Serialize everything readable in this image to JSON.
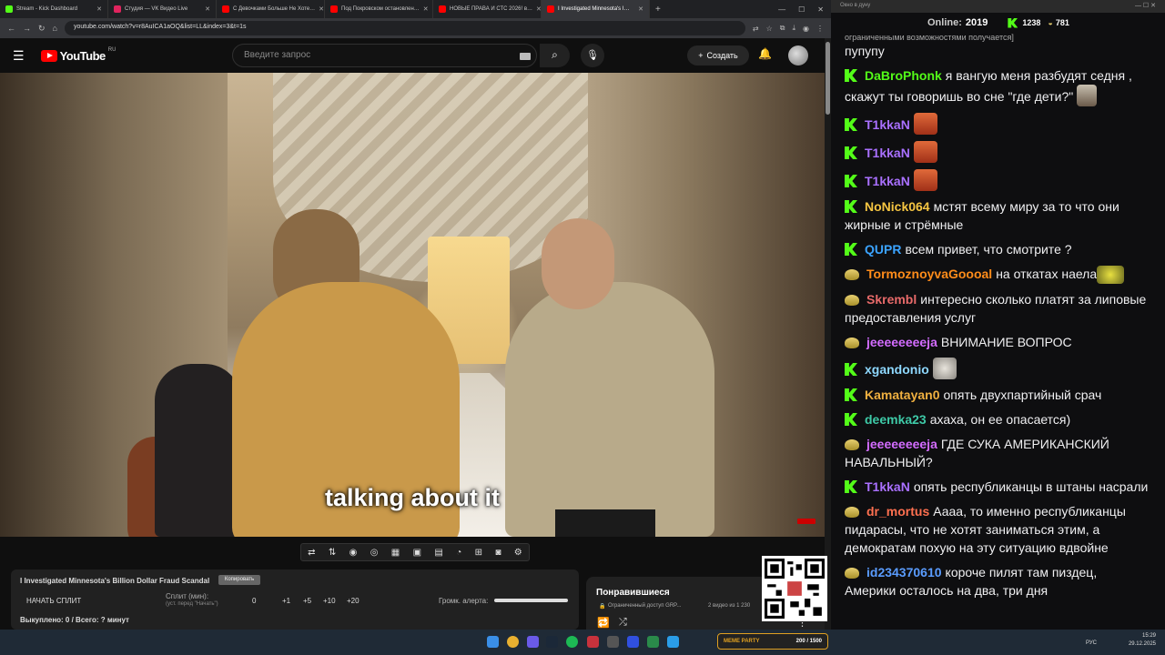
{
  "browser": {
    "tabs": [
      {
        "title": "Stream - Kick Dashboard",
        "favicon_color": "#53fc18"
      },
      {
        "title": "Студия — VK Видео Live",
        "favicon_color": "#e0245e"
      },
      {
        "title": "С Девочками Больше Не Хоте…",
        "favicon_color": "#ff0000"
      },
      {
        "title": "Под Покровском остановлен…",
        "favicon_color": "#ff0000"
      },
      {
        "title": "НОВЫЕ ПРАВА И СТС 2026! в…",
        "favicon_color": "#ff0000"
      },
      {
        "title": "I Investigated Minnesota's I…",
        "favicon_color": "#ff0000"
      }
    ],
    "url": "youtube.com/watch?v=r8AuICA1aOQ&list=LL&index=3&t=1s"
  },
  "youtube": {
    "logo_word": "YouTube",
    "region": "RU",
    "search_placeholder": "Введите запрос",
    "create_label": "Создать"
  },
  "video": {
    "subtitle": "talking about it"
  },
  "panel": {
    "video_title": "I Investigated Minnesota's Billion Dollar Fraud Scandal",
    "copy_label": "Копировать",
    "start_split_label": "НАЧАТЬ СПЛИТ",
    "split_label": "Сплит (мин):",
    "split_hint": "(уст. перед \"Начать\")",
    "split_value": "0",
    "increments": [
      "+1",
      "+5",
      "+10",
      "+20"
    ],
    "alert_volume_label": "Громк. алерта:",
    "alert_volume": 1.0,
    "bought_summary": "Выкуплено: 0 / Всего: ? минут"
  },
  "liked": {
    "title": "Понравившиеся",
    "access": "Ограниченный доступ GRP...",
    "count": "2 видео из 1 230"
  },
  "chat": {
    "window_title": "Окно в дуну",
    "online_label": "Online:",
    "online_count": "2019",
    "kick_count": "1238",
    "other_count": "781",
    "partial_top": "ограниченными возможностями получается]",
    "messages": [
      {
        "badge": "none",
        "user": "",
        "color": "#efeff1",
        "text": "пупупу"
      },
      {
        "badge": "kick",
        "user": "DaBroPhonk",
        "color": "#53fc18",
        "text": "я вангую меня разбудят седня , скажут ты говоришь во сне \"где дети?\""
      },
      {
        "badge": "kick",
        "user": "T1kkaN",
        "color": "#a970ff",
        "text": ""
      },
      {
        "badge": "kick",
        "user": "T1kkaN",
        "color": "#a970ff",
        "text": ""
      },
      {
        "badge": "kick",
        "user": "T1kkaN",
        "color": "#a970ff",
        "text": ""
      },
      {
        "badge": "kick",
        "user": "NoNick064",
        "color": "#f5c542",
        "text": "мстят всему миру за то что они жирные и стрёмные"
      },
      {
        "badge": "kick",
        "user": "QUPR",
        "color": "#3ba3ff",
        "text": "всем привет, что смотрите ?"
      },
      {
        "badge": "dog",
        "user": "TormoznoyvaGoooal",
        "color": "#ff8c1a",
        "text": "на откатах наела"
      },
      {
        "badge": "dog",
        "user": "Skrembl",
        "color": "#e86a6a",
        "text": "интересно сколько платят за липовые предоставления услуг"
      },
      {
        "badge": "dog",
        "user": "jeeeeeeeeja",
        "color": "#d36cff",
        "text": "ВНИМАНИЕ ВОПРОС"
      },
      {
        "badge": "kick",
        "user": "xgandonio",
        "color": "#8ed8ff",
        "text": ""
      },
      {
        "badge": "kick",
        "user": "Kamatayan0",
        "color": "#f0b040",
        "text": "опять двухпартийный срач"
      },
      {
        "badge": "kick",
        "user": "deemka23",
        "color": "#3ec9a7",
        "text": "ахаха, он ее опасается)"
      },
      {
        "badge": "dog",
        "user": "jeeeeeeeeja",
        "color": "#d36cff",
        "text": "ГДЕ СУКА АМЕРИКАНСКИЙ НАВАЛЬНЫЙ?"
      },
      {
        "badge": "kick",
        "user": "T1kkaN",
        "color": "#a970ff",
        "text": "опять республиканцы в штаны насрали"
      },
      {
        "badge": "dog",
        "user": "dr_mortus",
        "color": "#ff7050",
        "text": "Аааа, то именно республиканцы пидарасы, что не хотят заниматься этим, а демократам похую на эту ситуацию вдвойне"
      },
      {
        "badge": "dog",
        "user": "id234370610",
        "color": "#5a9cff",
        "text": "короче пилят там пиздец, Америки осталось на два, три дня"
      }
    ]
  },
  "taskbar": {
    "overlay_label": "MEME PARTY",
    "overlay_progress": "200 / 1500",
    "lang": "РУС",
    "time": "15:29",
    "date": "29.12.2025"
  }
}
